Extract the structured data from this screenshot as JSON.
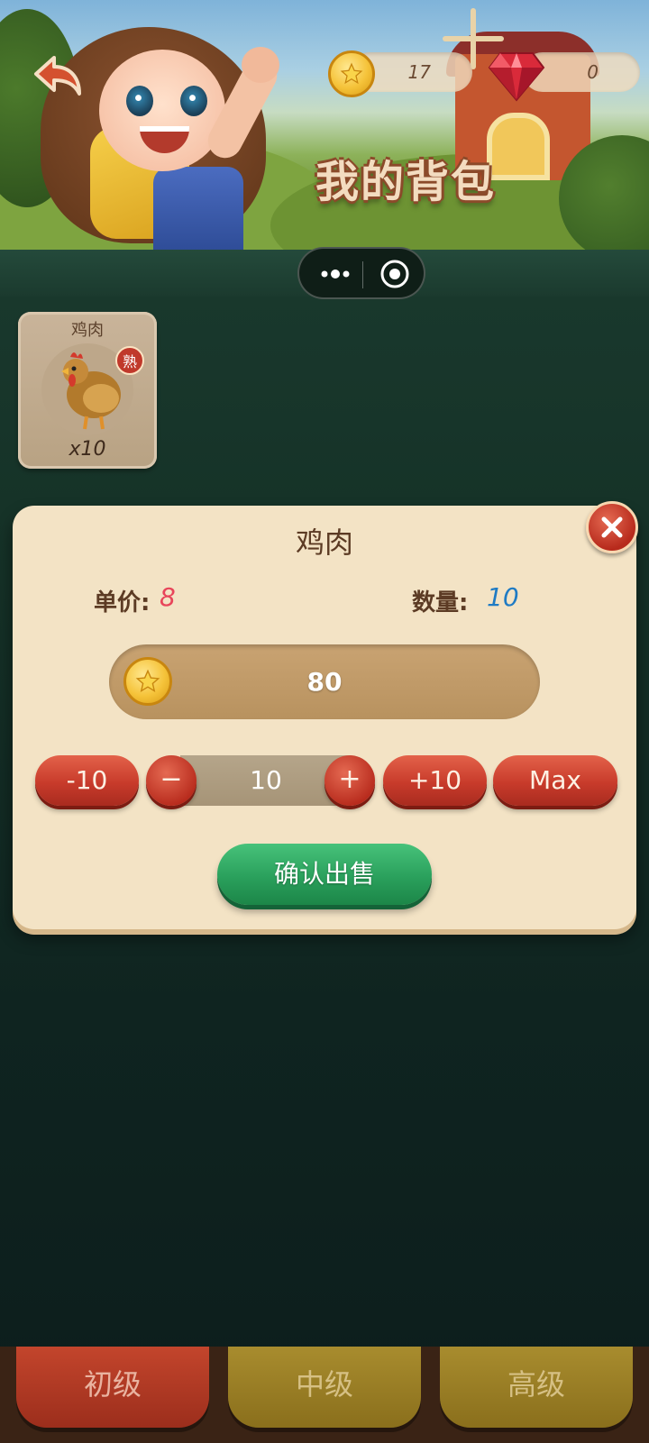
{
  "header": {
    "title": "我的背包",
    "coins": "17",
    "gems": "0"
  },
  "inventory": {
    "items": [
      {
        "name": "鸡肉",
        "badge": "熟",
        "count": "x10"
      }
    ]
  },
  "sell_dialog": {
    "title": "鸡肉",
    "price_label": "单价:",
    "price_value": "8",
    "quantity_label": "数量:",
    "quantity_value": "10",
    "total": "80",
    "minus_ten_label": "-10",
    "minus_label": "−",
    "stepper_value": "10",
    "plus_label": "+",
    "plus_ten_label": "+10",
    "max_label": "Max",
    "confirm_label": "确认出售"
  },
  "tabs": [
    {
      "label": "初级",
      "active": true
    },
    {
      "label": "中级",
      "active": false
    },
    {
      "label": "高级",
      "active": false
    }
  ],
  "colors": {
    "price": "#e8455a",
    "quantity": "#1f7bc4",
    "confirm": "#2aa05c",
    "danger": "#c83b2b"
  }
}
